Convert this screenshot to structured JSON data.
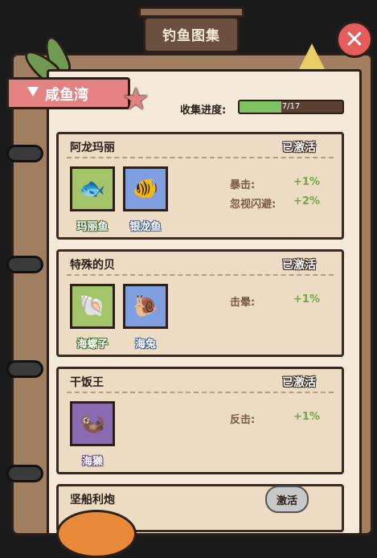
{
  "header": {
    "title": "钓鱼图集"
  },
  "section": {
    "name": "咸鱼湾"
  },
  "progress": {
    "label": "收集进度:",
    "text": "7/17",
    "fraction": 0.41
  },
  "cards": [
    {
      "title": "阿龙玛丽",
      "status": "已激活",
      "fish": [
        {
          "name": "玛丽鱼",
          "color": "green"
        },
        {
          "name": "银龙鱼",
          "color": "blue"
        }
      ],
      "bonuses": [
        {
          "label": "暴击:",
          "value": "+1%"
        },
        {
          "label": "忽视闪避:",
          "value": "+2%"
        }
      ]
    },
    {
      "title": "特殊的贝",
      "status": "已激活",
      "fish": [
        {
          "name": "海螺子",
          "color": "green"
        },
        {
          "name": "海兔",
          "color": "blue"
        }
      ],
      "bonuses": [
        {
          "label": "击晕:",
          "value": "+1%"
        }
      ]
    },
    {
      "title": "干饭王",
      "status": "已激活",
      "fish": [
        {
          "name": "海獭",
          "color": "purple"
        }
      ],
      "bonuses": [
        {
          "label": "反击:",
          "value": "+1%"
        }
      ]
    },
    {
      "title": "坚船利炮",
      "action": "激活"
    }
  ],
  "colors": {
    "accent_green": "#6fa84c",
    "ribbon": "#e48282",
    "close": "#e65c5c"
  }
}
